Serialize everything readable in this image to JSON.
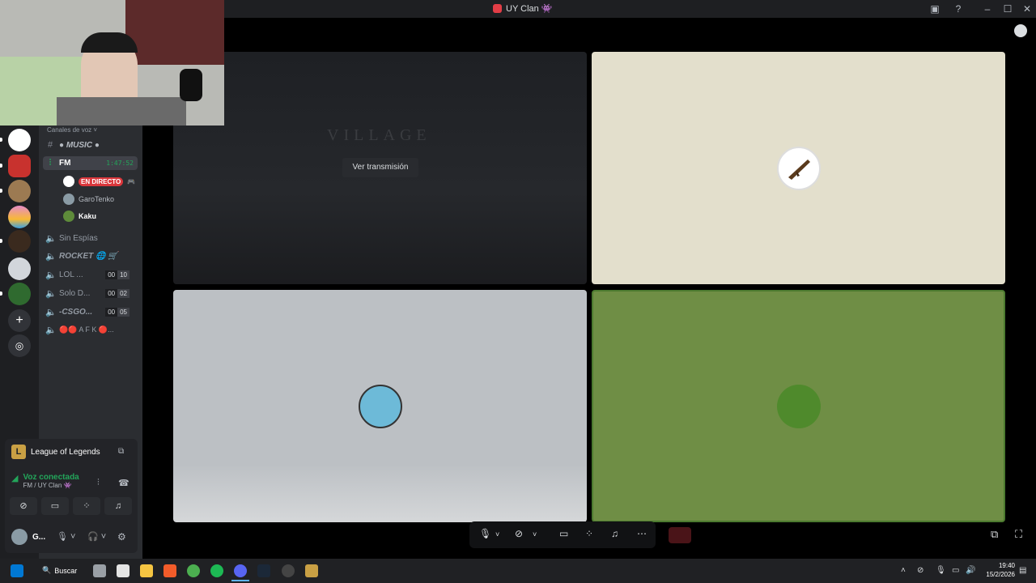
{
  "window": {
    "title": "UY Clan 👾"
  },
  "sidebar": {
    "section_label": "Canales de voz ˅",
    "channels": [
      {
        "name": "● MUSIC ●"
      },
      {
        "name": "FM",
        "timer": "1:47:52"
      },
      {
        "name": "Sin Espías"
      },
      {
        "name": "ROCKET 🌐 🛒"
      },
      {
        "name": "LOL ...",
        "count_a": "00",
        "count_b": "10"
      },
      {
        "name": "Solo D...",
        "count_a": "00",
        "count_b": "02"
      },
      {
        "name": "-CSGO...",
        "count_a": "00",
        "count_b": "05"
      },
      {
        "name": "🔴🔴 A F K 🔴..."
      }
    ],
    "voice_users": [
      {
        "name": "",
        "badge": "EN DIRECTO"
      },
      {
        "name": "GaroTenko"
      },
      {
        "name": "Kaku"
      }
    ]
  },
  "activity": {
    "game": "League of Legends",
    "voice_status": "Voz conectada",
    "voice_location": "FM / UY Clan 👾",
    "user_short": "G..."
  },
  "stage": {
    "watch_stream_label": "Ver transmisión",
    "stream_title": "VILLAGE"
  },
  "taskbar": {
    "search_label": "Buscar",
    "time": "19:40",
    "date": "15/2/2026"
  },
  "colors": {
    "tile_beige": "#e3dfcc",
    "tile_grey": "#bcc0c4",
    "tile_green": "#6f8e45",
    "live_red": "#da373c",
    "connected_green": "#23a55a"
  }
}
